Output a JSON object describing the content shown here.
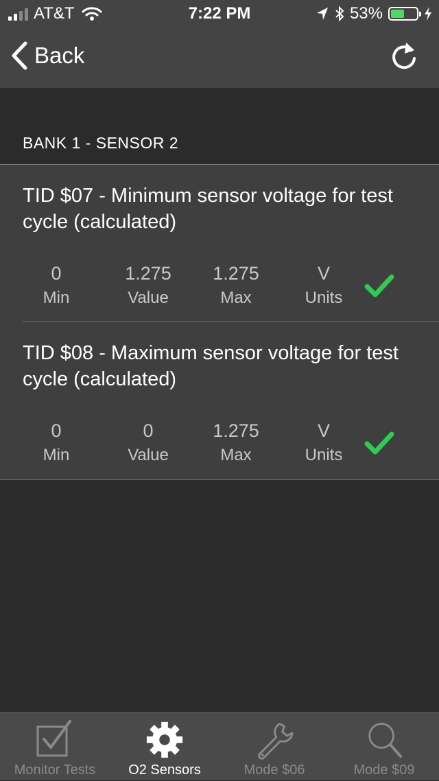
{
  "status_bar": {
    "carrier": "AT&T",
    "time": "7:22 PM",
    "battery_percent": "53%",
    "battery_level": 0.53,
    "signal_bars": 2,
    "icons": [
      "signal-icon",
      "wifi-icon",
      "location-icon",
      "bluetooth-icon",
      "battery-icon",
      "charging-icon"
    ]
  },
  "nav": {
    "back_label": "Back",
    "refresh_icon": "refresh-icon"
  },
  "section": {
    "title": "BANK 1 - SENSOR 2"
  },
  "tests": [
    {
      "title": "TID $07 - Minimum sensor voltage for test cycle (calculated)",
      "min": "0",
      "min_label": "Min",
      "value": "1.275",
      "value_label": "Value",
      "max": "1.275",
      "max_label": "Max",
      "units": "V",
      "units_label": "Units",
      "status": "pass"
    },
    {
      "title": "TID $08 - Maximum sensor voltage for test cycle (calculated)",
      "min": "0",
      "min_label": "Min",
      "value": "0",
      "value_label": "Value",
      "max": "1.275",
      "max_label": "Max",
      "units": "V",
      "units_label": "Units",
      "status": "pass"
    }
  ],
  "tabbar": {
    "tabs": [
      {
        "label": "Monitor Tests",
        "icon": "checkbox-icon",
        "active": false
      },
      {
        "label": "O2 Sensors",
        "icon": "gear-icon",
        "active": true
      },
      {
        "label": "Mode $06",
        "icon": "wrench-icon",
        "active": false
      },
      {
        "label": "Mode $09",
        "icon": "search-icon",
        "active": false
      }
    ]
  },
  "colors": {
    "header_bg": "#444444",
    "page_bg": "#2b2b2b",
    "card_bg": "#3f3f3f",
    "check_green": "#2ecc52",
    "battery_green": "#4cd964",
    "tab_inactive": "#8a8a8a",
    "tab_active": "#ffffff"
  }
}
